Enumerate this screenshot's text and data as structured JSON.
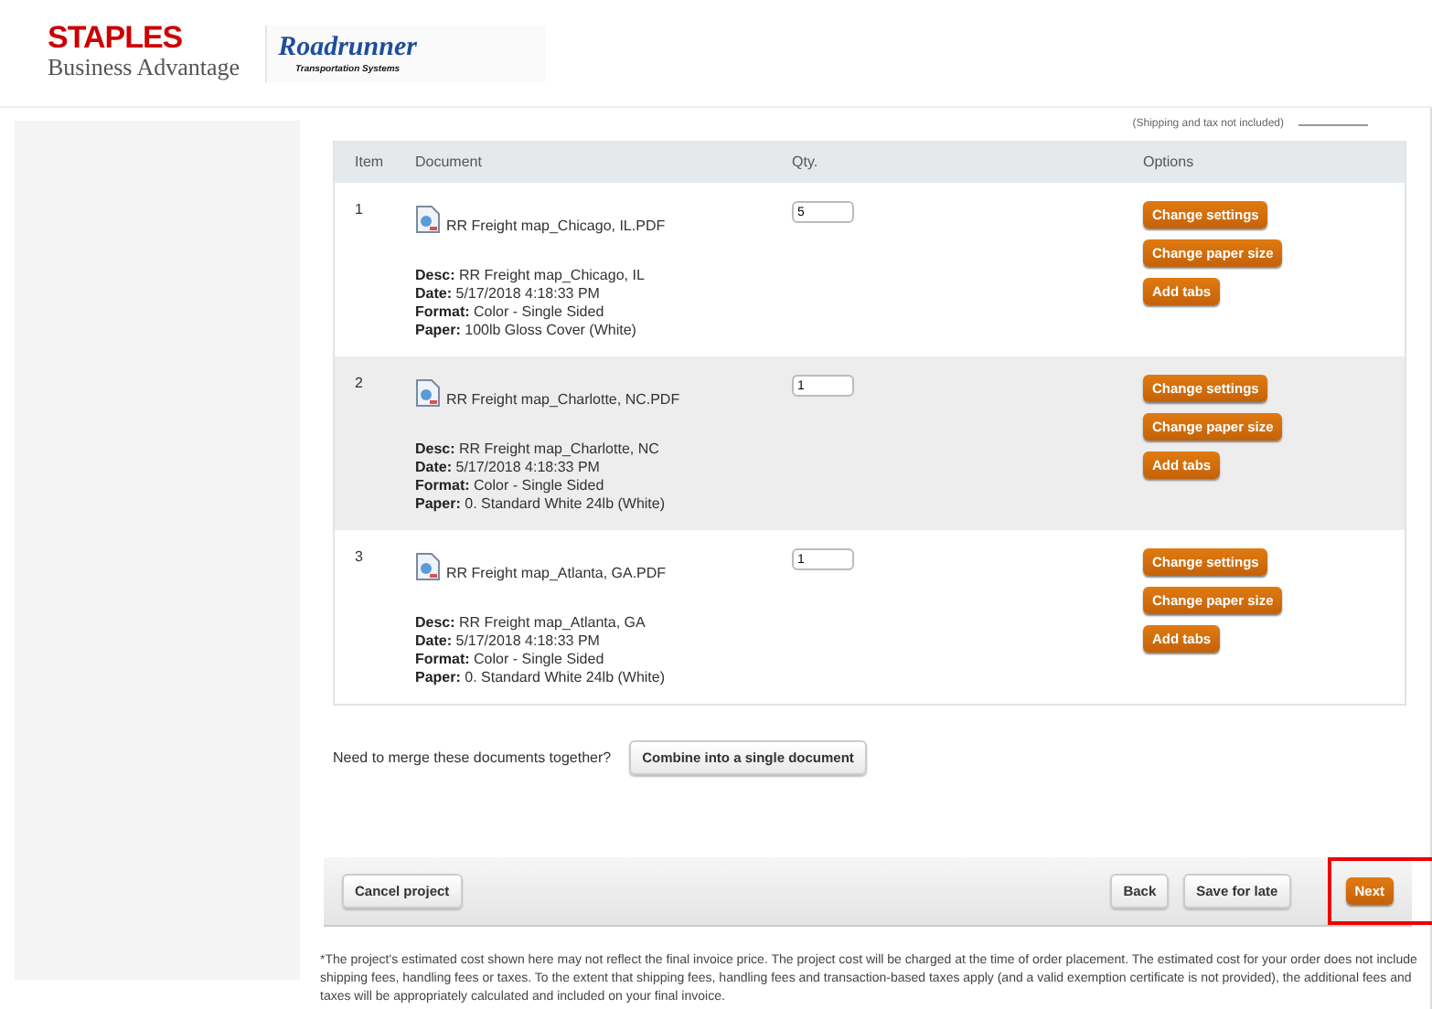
{
  "header": {
    "brand": "STAPLES",
    "brand_sub": "Business Advantage",
    "partner": "Roadrunner",
    "partner_sub": "Transportation Systems"
  },
  "price_note": "(Shipping and tax not included)",
  "table": {
    "columns": [
      "Item",
      "Document",
      "Qty.",
      "Options"
    ],
    "rows": [
      {
        "item": "1",
        "file": "RR Freight map_Chicago, IL.PDF",
        "details": [
          "**Desc:** RR Freight map_Chicago, IL",
          "**Date:** 5/17/2018 4:18:33 PM",
          "**Format:** Color - Single Sided",
          "**Paper:** 100lb Gloss Cover (White)"
        ],
        "qty": "5",
        "options": [
          "Change settings",
          "Change paper size",
          "Add tabs"
        ]
      },
      {
        "item": "2",
        "file": "RR Freight map_Charlotte, NC.PDF",
        "details": [
          "**Desc:** RR Freight map_Charlotte, NC",
          "**Date:** 5/17/2018 4:18:33 PM",
          "**Format:** Color - Single Sided",
          "**Paper:** 0. Standard White 24lb (White)"
        ],
        "qty": "1",
        "options": [
          "Change settings",
          "Change paper size",
          "Add tabs"
        ]
      },
      {
        "item": "3",
        "file": "RR Freight map_Atlanta, GA.PDF",
        "details": [
          "**Desc:** RR Freight map_Atlanta, GA",
          "**Date:** 5/17/2018 4:18:33 PM",
          "**Format:** Color - Single Sided",
          "**Paper:** 0. Standard White 24lb (White)"
        ],
        "qty": "1",
        "options": [
          "Change settings",
          "Change paper size",
          "Add tabs"
        ]
      }
    ]
  },
  "merge": {
    "question": "Need to merge these documents together?",
    "button": "Combine into a single document"
  },
  "footer": {
    "cancel": "Cancel project",
    "back": "Back",
    "save": "Save for late",
    "next": "Next"
  },
  "disclaimer": "*The project's estimated cost shown here may not reflect the final invoice price. The project cost will be charged at the time of order placement. The estimated cost for your order does not include shipping fees, handling fees or taxes. To the extent that shipping fees, handling fees and transaction-based taxes apply (and a valid exemption certificate is not provided), the additional fees and taxes will be appropriately calculated and included on your final invoice."
}
